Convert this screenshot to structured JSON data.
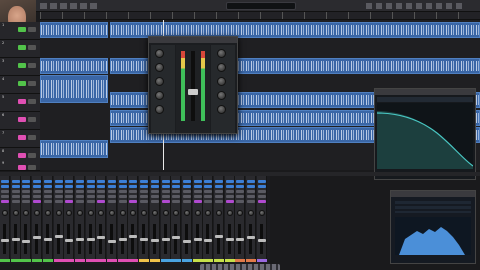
{
  "app": {
    "menu_left": "",
    "menu_right": ""
  },
  "transport": {
    "lcd": ""
  },
  "tracks": [
    {
      "num": "1",
      "color": "#52c34a"
    },
    {
      "num": "2",
      "color": "#52c34a"
    },
    {
      "num": "3",
      "color": "#52c34a"
    },
    {
      "num": "4",
      "color": "#52c34a"
    },
    {
      "num": "5",
      "color": "#e04fb3"
    },
    {
      "num": "6",
      "color": "#e04fb3"
    },
    {
      "num": "7",
      "color": "#e04fb3"
    },
    {
      "num": "8",
      "color": "#e04fb3"
    },
    {
      "num": "9",
      "color": "#e04fb3"
    }
  ],
  "plugin_channel": {
    "title": "",
    "brand": ""
  },
  "plugin_analyzer": {
    "title": "",
    "footer": ""
  },
  "plugin_meter": {
    "title": "",
    "footer": ""
  },
  "mixer": {
    "strip_colors": [
      "#52c34a",
      "#52c34a",
      "#52c34a",
      "#52c34a",
      "#52c34a",
      "#e04fb3",
      "#e04fb3",
      "#e04fb3",
      "#e04fb3",
      "#e04fb3",
      "#e04fb3",
      "#e04fb3",
      "#e04fb3",
      "#f0c24a",
      "#f0c24a",
      "#4aa3e0",
      "#4aa3e0",
      "#4aa3e0",
      "#c6e04a",
      "#c6e04a",
      "#c6e04a",
      "#c6e04a",
      "#e07a4a",
      "#e07a4a",
      "#9b6ae0"
    ]
  },
  "colors": {
    "region": "#3a66a6",
    "accent": "#4f7fc0",
    "background": "#1a1a1c"
  }
}
